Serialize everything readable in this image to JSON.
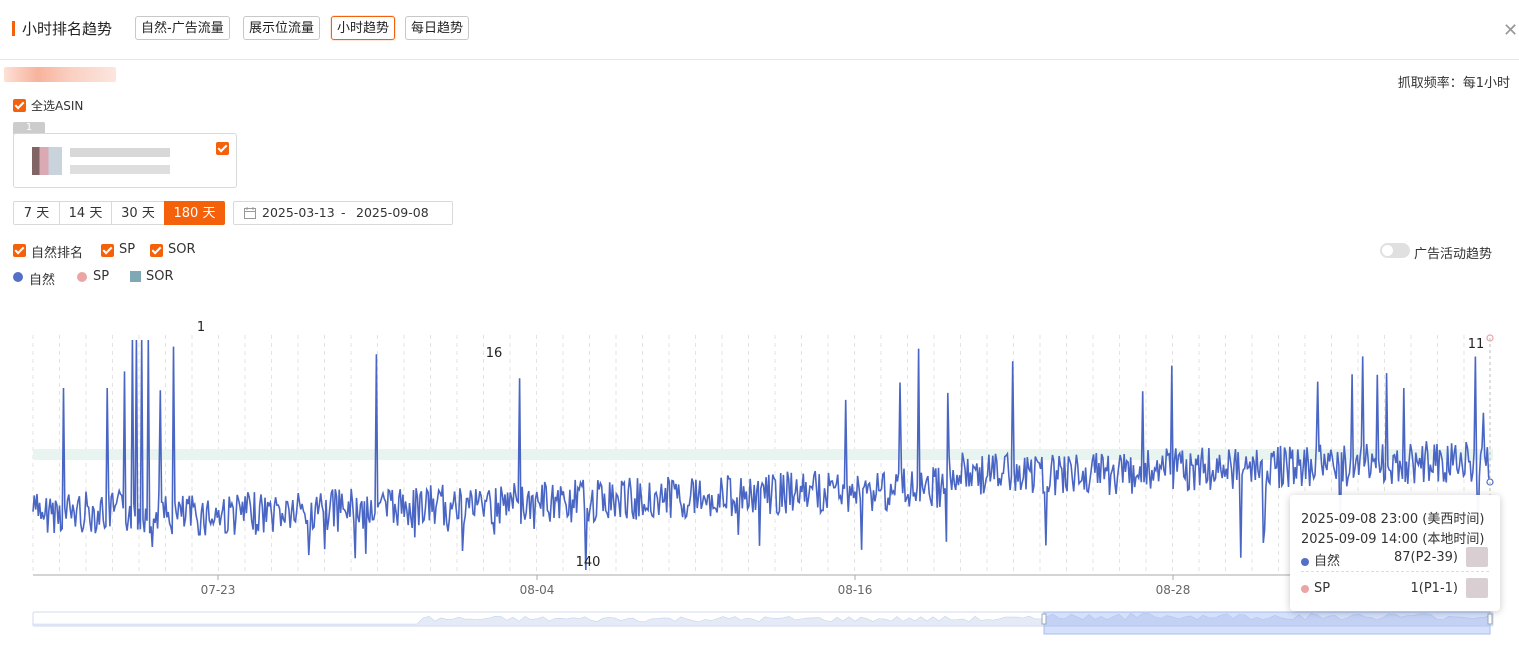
{
  "header": {
    "title": "小时排名趋势",
    "tabs": [
      {
        "label": "自然-广告流量",
        "active": false
      },
      {
        "label": "展示位流量",
        "active": false
      },
      {
        "label": "小时趋势",
        "active": true
      },
      {
        "label": "每日趋势",
        "active": false
      }
    ],
    "close_icon": "close-icon"
  },
  "info": {
    "frequency": "抓取频率：每1小时"
  },
  "asin_select": {
    "select_all_label": "全选ASIN",
    "card_index": "1",
    "card_checked": true
  },
  "time_range": {
    "options": [
      "7 天",
      "14 天",
      "30 天",
      "180 天"
    ],
    "active": "180 天",
    "date_start": "2025-03-13",
    "date_sep": "-",
    "date_end": "2025-09-08",
    "calendar_icon": "calendar-icon"
  },
  "series_toggles": [
    {
      "label": "自然排名",
      "checked": true
    },
    {
      "label": "SP",
      "checked": true
    },
    {
      "label": "SOR",
      "checked": true
    }
  ],
  "ad_trend_toggle": {
    "label": "广告活动趋势",
    "on": false
  },
  "legend": [
    {
      "label": "自然",
      "color": "#5470c6",
      "shape": "circle"
    },
    {
      "label": "SP",
      "color": "#eca5a5",
      "shape": "circle"
    },
    {
      "label": "SOR",
      "color": "#7fa8b4",
      "shape": "square"
    }
  ],
  "chart_data": {
    "type": "line",
    "x_tick_labels": [
      "07-23",
      "08-04",
      "08-16",
      "08-28"
    ],
    "y_inverted": true,
    "series": [
      {
        "name": "自然",
        "color": "#5470c6",
        "key_points": [
          {
            "label": "1",
            "x": "07-19"
          },
          {
            "label": "16",
            "x": "07-30"
          },
          {
            "label": "140",
            "x": "08-06"
          },
          {
            "label": "11",
            "x": "09-08"
          }
        ],
        "value_range": [
          1,
          140
        ]
      }
    ],
    "annotations": [
      "1",
      "16",
      "140",
      "11"
    ]
  },
  "tooltip": {
    "time_us": "2025-09-08 23:00 (美西时间)",
    "time_local": "2025-09-09 14:00 (本地时间)",
    "rows": [
      {
        "label": "自然",
        "value": "87(P2-39)",
        "color": "#5470c6"
      },
      {
        "label": "SP",
        "value": "1(P1-1)",
        "color": "#eca5a5"
      }
    ]
  }
}
